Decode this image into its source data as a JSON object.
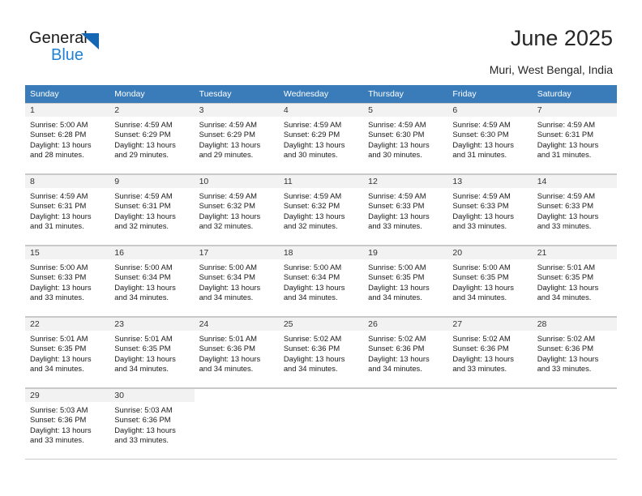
{
  "brand": {
    "word_general": "General",
    "word_blue": "Blue",
    "accent_color": "#1567b4",
    "accent_color_light": "#1f82d4"
  },
  "header": {
    "title": "June 2025",
    "subtitle": "Muri, West Bengal, India"
  },
  "calendar": {
    "header_bg": "#3a7cba",
    "daynum_bg": "#f2f2f2",
    "weekday_headers": [
      "Sunday",
      "Monday",
      "Tuesday",
      "Wednesday",
      "Thursday",
      "Friday",
      "Saturday"
    ],
    "weeks": [
      [
        {
          "day": "1",
          "sunrise": "Sunrise: 5:00 AM",
          "sunset": "Sunset: 6:28 PM",
          "daylight_line1": "Daylight: 13 hours",
          "daylight_line2": "and 28 minutes."
        },
        {
          "day": "2",
          "sunrise": "Sunrise: 4:59 AM",
          "sunset": "Sunset: 6:29 PM",
          "daylight_line1": "Daylight: 13 hours",
          "daylight_line2": "and 29 minutes."
        },
        {
          "day": "3",
          "sunrise": "Sunrise: 4:59 AM",
          "sunset": "Sunset: 6:29 PM",
          "daylight_line1": "Daylight: 13 hours",
          "daylight_line2": "and 29 minutes."
        },
        {
          "day": "4",
          "sunrise": "Sunrise: 4:59 AM",
          "sunset": "Sunset: 6:29 PM",
          "daylight_line1": "Daylight: 13 hours",
          "daylight_line2": "and 30 minutes."
        },
        {
          "day": "5",
          "sunrise": "Sunrise: 4:59 AM",
          "sunset": "Sunset: 6:30 PM",
          "daylight_line1": "Daylight: 13 hours",
          "daylight_line2": "and 30 minutes."
        },
        {
          "day": "6",
          "sunrise": "Sunrise: 4:59 AM",
          "sunset": "Sunset: 6:30 PM",
          "daylight_line1": "Daylight: 13 hours",
          "daylight_line2": "and 31 minutes."
        },
        {
          "day": "7",
          "sunrise": "Sunrise: 4:59 AM",
          "sunset": "Sunset: 6:31 PM",
          "daylight_line1": "Daylight: 13 hours",
          "daylight_line2": "and 31 minutes."
        }
      ],
      [
        {
          "day": "8",
          "sunrise": "Sunrise: 4:59 AM",
          "sunset": "Sunset: 6:31 PM",
          "daylight_line1": "Daylight: 13 hours",
          "daylight_line2": "and 31 minutes."
        },
        {
          "day": "9",
          "sunrise": "Sunrise: 4:59 AM",
          "sunset": "Sunset: 6:31 PM",
          "daylight_line1": "Daylight: 13 hours",
          "daylight_line2": "and 32 minutes."
        },
        {
          "day": "10",
          "sunrise": "Sunrise: 4:59 AM",
          "sunset": "Sunset: 6:32 PM",
          "daylight_line1": "Daylight: 13 hours",
          "daylight_line2": "and 32 minutes."
        },
        {
          "day": "11",
          "sunrise": "Sunrise: 4:59 AM",
          "sunset": "Sunset: 6:32 PM",
          "daylight_line1": "Daylight: 13 hours",
          "daylight_line2": "and 32 minutes."
        },
        {
          "day": "12",
          "sunrise": "Sunrise: 4:59 AM",
          "sunset": "Sunset: 6:33 PM",
          "daylight_line1": "Daylight: 13 hours",
          "daylight_line2": "and 33 minutes."
        },
        {
          "day": "13",
          "sunrise": "Sunrise: 4:59 AM",
          "sunset": "Sunset: 6:33 PM",
          "daylight_line1": "Daylight: 13 hours",
          "daylight_line2": "and 33 minutes."
        },
        {
          "day": "14",
          "sunrise": "Sunrise: 4:59 AM",
          "sunset": "Sunset: 6:33 PM",
          "daylight_line1": "Daylight: 13 hours",
          "daylight_line2": "and 33 minutes."
        }
      ],
      [
        {
          "day": "15",
          "sunrise": "Sunrise: 5:00 AM",
          "sunset": "Sunset: 6:33 PM",
          "daylight_line1": "Daylight: 13 hours",
          "daylight_line2": "and 33 minutes."
        },
        {
          "day": "16",
          "sunrise": "Sunrise: 5:00 AM",
          "sunset": "Sunset: 6:34 PM",
          "daylight_line1": "Daylight: 13 hours",
          "daylight_line2": "and 34 minutes."
        },
        {
          "day": "17",
          "sunrise": "Sunrise: 5:00 AM",
          "sunset": "Sunset: 6:34 PM",
          "daylight_line1": "Daylight: 13 hours",
          "daylight_line2": "and 34 minutes."
        },
        {
          "day": "18",
          "sunrise": "Sunrise: 5:00 AM",
          "sunset": "Sunset: 6:34 PM",
          "daylight_line1": "Daylight: 13 hours",
          "daylight_line2": "and 34 minutes."
        },
        {
          "day": "19",
          "sunrise": "Sunrise: 5:00 AM",
          "sunset": "Sunset: 6:35 PM",
          "daylight_line1": "Daylight: 13 hours",
          "daylight_line2": "and 34 minutes."
        },
        {
          "day": "20",
          "sunrise": "Sunrise: 5:00 AM",
          "sunset": "Sunset: 6:35 PM",
          "daylight_line1": "Daylight: 13 hours",
          "daylight_line2": "and 34 minutes."
        },
        {
          "day": "21",
          "sunrise": "Sunrise: 5:01 AM",
          "sunset": "Sunset: 6:35 PM",
          "daylight_line1": "Daylight: 13 hours",
          "daylight_line2": "and 34 minutes."
        }
      ],
      [
        {
          "day": "22",
          "sunrise": "Sunrise: 5:01 AM",
          "sunset": "Sunset: 6:35 PM",
          "daylight_line1": "Daylight: 13 hours",
          "daylight_line2": "and 34 minutes."
        },
        {
          "day": "23",
          "sunrise": "Sunrise: 5:01 AM",
          "sunset": "Sunset: 6:35 PM",
          "daylight_line1": "Daylight: 13 hours",
          "daylight_line2": "and 34 minutes."
        },
        {
          "day": "24",
          "sunrise": "Sunrise: 5:01 AM",
          "sunset": "Sunset: 6:36 PM",
          "daylight_line1": "Daylight: 13 hours",
          "daylight_line2": "and 34 minutes."
        },
        {
          "day": "25",
          "sunrise": "Sunrise: 5:02 AM",
          "sunset": "Sunset: 6:36 PM",
          "daylight_line1": "Daylight: 13 hours",
          "daylight_line2": "and 34 minutes."
        },
        {
          "day": "26",
          "sunrise": "Sunrise: 5:02 AM",
          "sunset": "Sunset: 6:36 PM",
          "daylight_line1": "Daylight: 13 hours",
          "daylight_line2": "and 34 minutes."
        },
        {
          "day": "27",
          "sunrise": "Sunrise: 5:02 AM",
          "sunset": "Sunset: 6:36 PM",
          "daylight_line1": "Daylight: 13 hours",
          "daylight_line2": "and 33 minutes."
        },
        {
          "day": "28",
          "sunrise": "Sunrise: 5:02 AM",
          "sunset": "Sunset: 6:36 PM",
          "daylight_line1": "Daylight: 13 hours",
          "daylight_line2": "and 33 minutes."
        }
      ],
      [
        {
          "day": "29",
          "sunrise": "Sunrise: 5:03 AM",
          "sunset": "Sunset: 6:36 PM",
          "daylight_line1": "Daylight: 13 hours",
          "daylight_line2": "and 33 minutes."
        },
        {
          "day": "30",
          "sunrise": "Sunrise: 5:03 AM",
          "sunset": "Sunset: 6:36 PM",
          "daylight_line1": "Daylight: 13 hours",
          "daylight_line2": "and 33 minutes."
        },
        {
          "day": "",
          "sunrise": "",
          "sunset": "",
          "daylight_line1": "",
          "daylight_line2": ""
        },
        {
          "day": "",
          "sunrise": "",
          "sunset": "",
          "daylight_line1": "",
          "daylight_line2": ""
        },
        {
          "day": "",
          "sunrise": "",
          "sunset": "",
          "daylight_line1": "",
          "daylight_line2": ""
        },
        {
          "day": "",
          "sunrise": "",
          "sunset": "",
          "daylight_line1": "",
          "daylight_line2": ""
        },
        {
          "day": "",
          "sunrise": "",
          "sunset": "",
          "daylight_line1": "",
          "daylight_line2": ""
        }
      ]
    ]
  }
}
